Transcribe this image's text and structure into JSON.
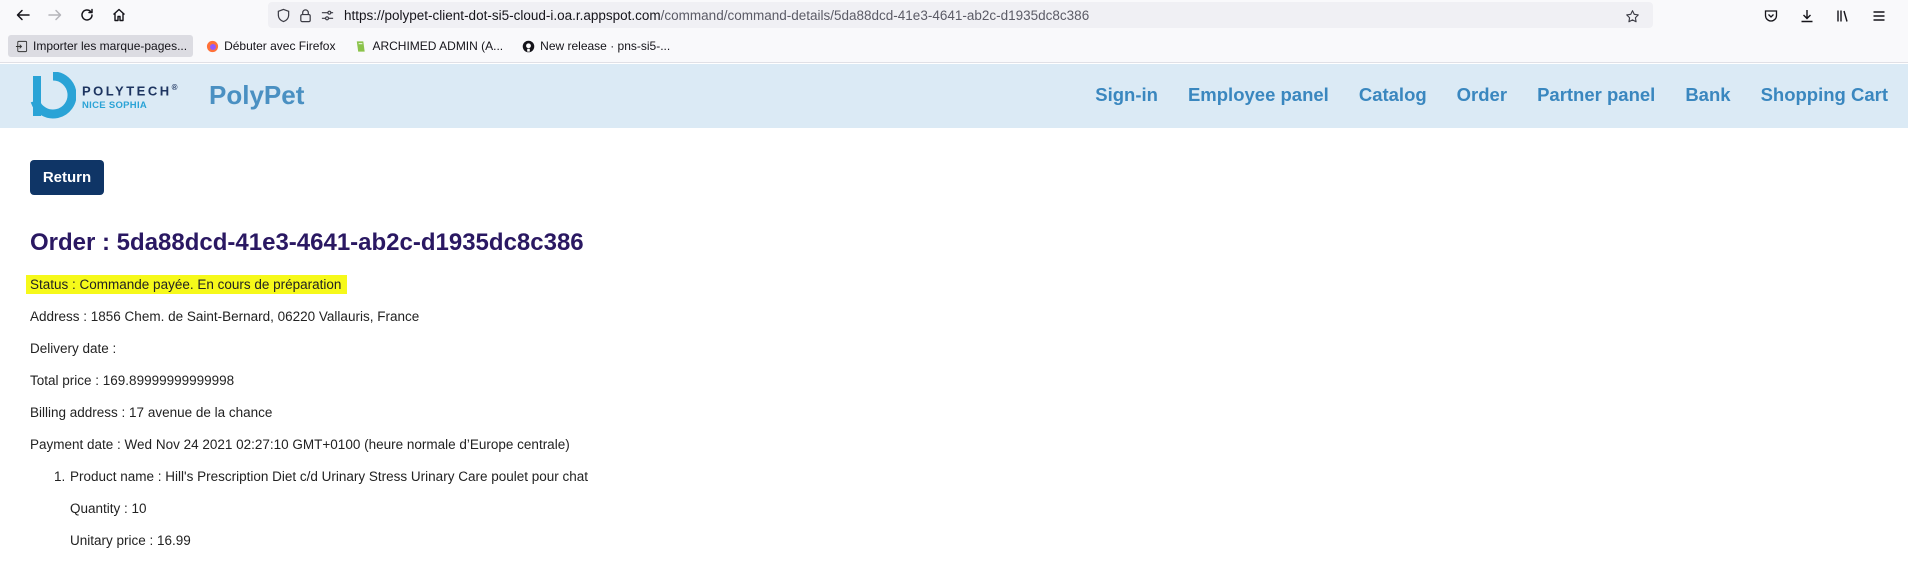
{
  "browser": {
    "url_domain": "https://polypet-client-dot-si5-cloud-i.oa.r.appspot.com",
    "url_path": "/command/command-details/5da88dcd-41e3-4641-ab2c-d1935dc8c386",
    "bookmarks": [
      {
        "label": "Importer les marque-pages...",
        "icon": "import-icon"
      },
      {
        "label": "Débuter avec Firefox",
        "icon": "firefox-icon"
      },
      {
        "label": "ARCHIMED ADMIN (A...",
        "icon": "archimed-icon"
      },
      {
        "label": "New release · pns-si5-...",
        "icon": "github-icon"
      }
    ]
  },
  "header": {
    "logo_word": "POLYTECH",
    "logo_reg": "®",
    "logo_sub": "NICE SOPHIA",
    "app_title": "PolyPet",
    "nav": [
      "Sign-in",
      "Employee panel",
      "Catalog",
      "Order",
      "Partner panel",
      "Bank",
      "Shopping Cart"
    ]
  },
  "order": {
    "return_label": "Return",
    "title": "Order : 5da88dcd-41e3-4641-ab2c-d1935dc8c386",
    "status": "Status : Commande payée. En cours de préparation",
    "address": "Address : 1856 Chem. de Saint-Bernard, 06220 Vallauris, France",
    "delivery_date": "Delivery date :",
    "total_price": "Total price : 169.89999999999998",
    "billing_address": "Billing address : 17 avenue de la chance",
    "payment_date": "Payment date : Wed Nov 24 2021 02:27:10 GMT+0100 (heure normale d’Europe centrale)",
    "items": [
      {
        "number": "1.",
        "product_name": "Product name : Hill's Prescription Diet c/d Urinary Stress Urinary Care poulet pour chat",
        "quantity": "Quantity : 10",
        "unitary_price": "Unitary price : 16.99"
      }
    ]
  },
  "colors": {
    "header_bg": "#dbeaf5",
    "nav_link": "#3a87bf",
    "return_bg": "#0f3566",
    "title": "#2a1862",
    "highlight": "#f6f91a"
  }
}
